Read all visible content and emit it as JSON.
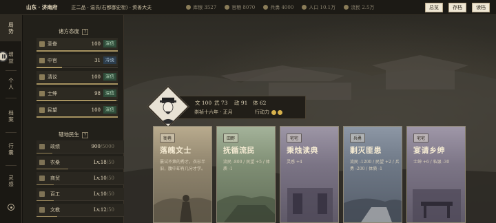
{
  "topbar": {
    "location": "山东 · 济南府",
    "rank": "正二品 · 温氏(右都御史衔) · 资善大夫",
    "stats": [
      {
        "label": "库银 3527",
        "icon": "silver-icon"
      },
      {
        "label": "官粮 8070",
        "icon": "grain-icon"
      },
      {
        "label": "兵勇 4000",
        "icon": "soldier-icon"
      },
      {
        "label": "人口 10.1万",
        "icon": "population-icon"
      },
      {
        "label": "流民 2.5万",
        "icon": "refugee-icon"
      }
    ],
    "buttons": [
      "总览",
      "存档",
      "读档"
    ]
  },
  "nav": {
    "items": [
      "局势",
      "增益",
      "个人",
      "档案",
      "行囊",
      "灵感"
    ]
  },
  "factions": {
    "title": "诸方态度",
    "help": "?",
    "rows": [
      {
        "name": "圣眷",
        "value": "100",
        "tag": "深信",
        "tag_type": "good",
        "level": 1.0
      },
      {
        "name": "中官",
        "value": "31",
        "tag": "冷淡",
        "tag_type": "bad",
        "level": 0.31
      },
      {
        "name": "清议",
        "value": "100",
        "tag": "深信",
        "tag_type": "good",
        "level": 1.0
      },
      {
        "name": "士绅",
        "value": "98",
        "tag": "深信",
        "tag_type": "good",
        "level": 0.98
      },
      {
        "name": "民望",
        "value": "100",
        "tag": "深信",
        "tag_type": "good",
        "level": 1.0
      }
    ]
  },
  "livelihood": {
    "title": "辖地民生",
    "help": "?",
    "rows": [
      {
        "name": "政绩",
        "value": "900",
        "max": "/5000",
        "level": 0.18
      },
      {
        "name": "农桑",
        "value": "Lv.18",
        "max": "/50",
        "level": 0.36
      },
      {
        "name": "商贸",
        "value": "Lv.10",
        "max": "/50",
        "level": 0.2
      },
      {
        "name": "百工",
        "value": "Lv.10",
        "max": "/50",
        "level": 0.2
      },
      {
        "name": "文教",
        "value": "Lv.12",
        "max": "/50",
        "level": 0.24
      }
    ]
  },
  "character": {
    "attrs": [
      {
        "key": "文",
        "value": "100"
      },
      {
        "key": "武",
        "value": "73"
      },
      {
        "key": "政",
        "value": "91"
      },
      {
        "key": "体",
        "value": "62"
      }
    ],
    "date": "崇祯十六年 · 正月",
    "action_label": "行动力",
    "action_points": 2
  },
  "cards": [
    {
      "category": "衙巷",
      "title": "落魄文士",
      "desc": "屡试不第的秀才，衣衫半旧，腹中却有几分才学。"
    },
    {
      "category": "田野",
      "title": "抚循流民",
      "desc": "流民 -800 / 民望 +5 / 体质 -1"
    },
    {
      "category": "宅宅",
      "title": "秉烛读典",
      "desc": "灵感 +4"
    },
    {
      "category": "兵勇",
      "title": "剿灭匪患",
      "desc": "流民 -1200 / 民望 +2 / 兵勇 -200 / 体质 -1"
    },
    {
      "category": "宅宅",
      "title": "宴请乡绅",
      "desc": "士绅 +6 / 私银 -30"
    }
  ],
  "colors": {
    "accent_gold": "#d8b24c",
    "tag_good": "#2f4d3a",
    "tag_bad": "#2c3d4d"
  }
}
